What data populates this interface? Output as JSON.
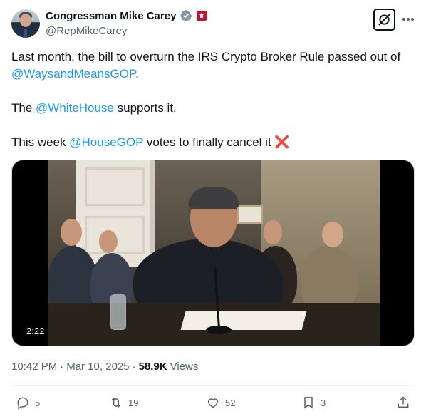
{
  "author": {
    "display_name": "Congressman Mike Carey",
    "handle": "@RepMikeCarey"
  },
  "tweet": {
    "line1_text": "Last month, the bill to overturn the IRS Crypto Broker Rule passed out of",
    "line1_mention": "@WaysandMeansGOP",
    "line1_end": ".",
    "line2_start": "The ",
    "line2_mention": "@WhiteHouse",
    "line2_end": " supports it.",
    "line3_start": "This week ",
    "line3_mention": "@HouseGOP",
    "line3_end": " votes to finally cancel it",
    "line3_emoji": "❌"
  },
  "media": {
    "duration": "2:22"
  },
  "meta": {
    "time": "10:42 PM",
    "sep1": "·",
    "date": "Mar 10, 2025",
    "sep2": "·",
    "views_count": "58.9K",
    "views_label": "Views"
  },
  "actions": {
    "replies": "5",
    "reposts": "19",
    "likes": "52",
    "bookmarks": "3"
  },
  "colors": {
    "link": "#1d9bf0",
    "text": "#0f1419",
    "secondary": "#536471",
    "verified": "#829aab",
    "affiliation": "#c8102e"
  },
  "icons": [
    "verified-badge-icon",
    "house-affiliation-icon",
    "grok-icon",
    "more-icon",
    "reply-icon",
    "repost-icon",
    "like-icon",
    "bookmark-icon",
    "share-icon"
  ]
}
